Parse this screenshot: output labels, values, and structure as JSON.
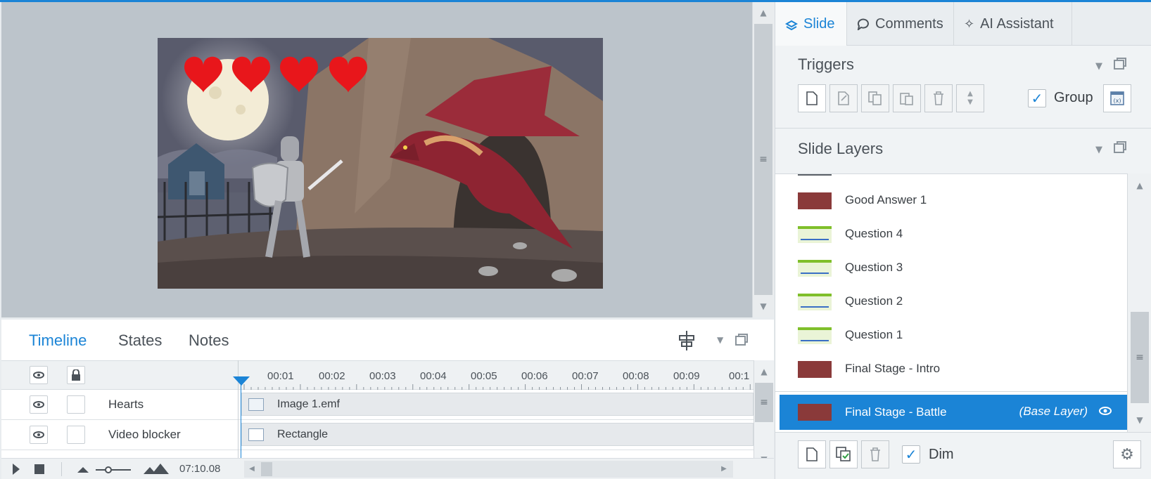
{
  "colors": {
    "accent": "#1b84d6",
    "selected_row": "#1b84d6",
    "heart": "#e8161b"
  },
  "stage": {
    "hearts_count": 4
  },
  "timeline": {
    "tabs": [
      {
        "label": "Timeline",
        "active": true
      },
      {
        "label": "States",
        "active": false
      },
      {
        "label": "Notes",
        "active": false
      }
    ],
    "ruler": [
      "00:01",
      "00:02",
      "00:03",
      "00:04",
      "00:05",
      "00:06",
      "00:07",
      "00:08",
      "00:09",
      "00:1"
    ],
    "rows": [
      {
        "name": "Hearts",
        "object_label": "Image 1.emf",
        "object_icon": "image-icon"
      },
      {
        "name": "Video blocker",
        "object_label": "Rectangle",
        "object_icon": "rectangle-icon"
      }
    ],
    "duration": "07:10.08"
  },
  "right_panel": {
    "tabs": [
      {
        "label": "Slide",
        "icon": "slide-icon",
        "active": true
      },
      {
        "label": "Comments",
        "icon": "comment-icon",
        "active": false
      },
      {
        "label": "AI Assistant",
        "icon": "sparkle-icon",
        "active": false
      }
    ],
    "triggers": {
      "title": "Triggers",
      "group_label": "Group",
      "group_checked": true
    },
    "slide_layers": {
      "title": "Slide Layers",
      "items": [
        {
          "name": "Good Answer 1",
          "thumb": "picture"
        },
        {
          "name": "Question 4",
          "thumb": "question"
        },
        {
          "name": "Question 3",
          "thumb": "question"
        },
        {
          "name": "Question 2",
          "thumb": "question"
        },
        {
          "name": "Question 1",
          "thumb": "question"
        },
        {
          "name": "Final Stage - Intro",
          "thumb": "picture"
        }
      ],
      "selected": {
        "name": "Final Stage - Battle",
        "tag": "(Base Layer)"
      },
      "dim_label": "Dim",
      "dim_checked": true
    }
  }
}
